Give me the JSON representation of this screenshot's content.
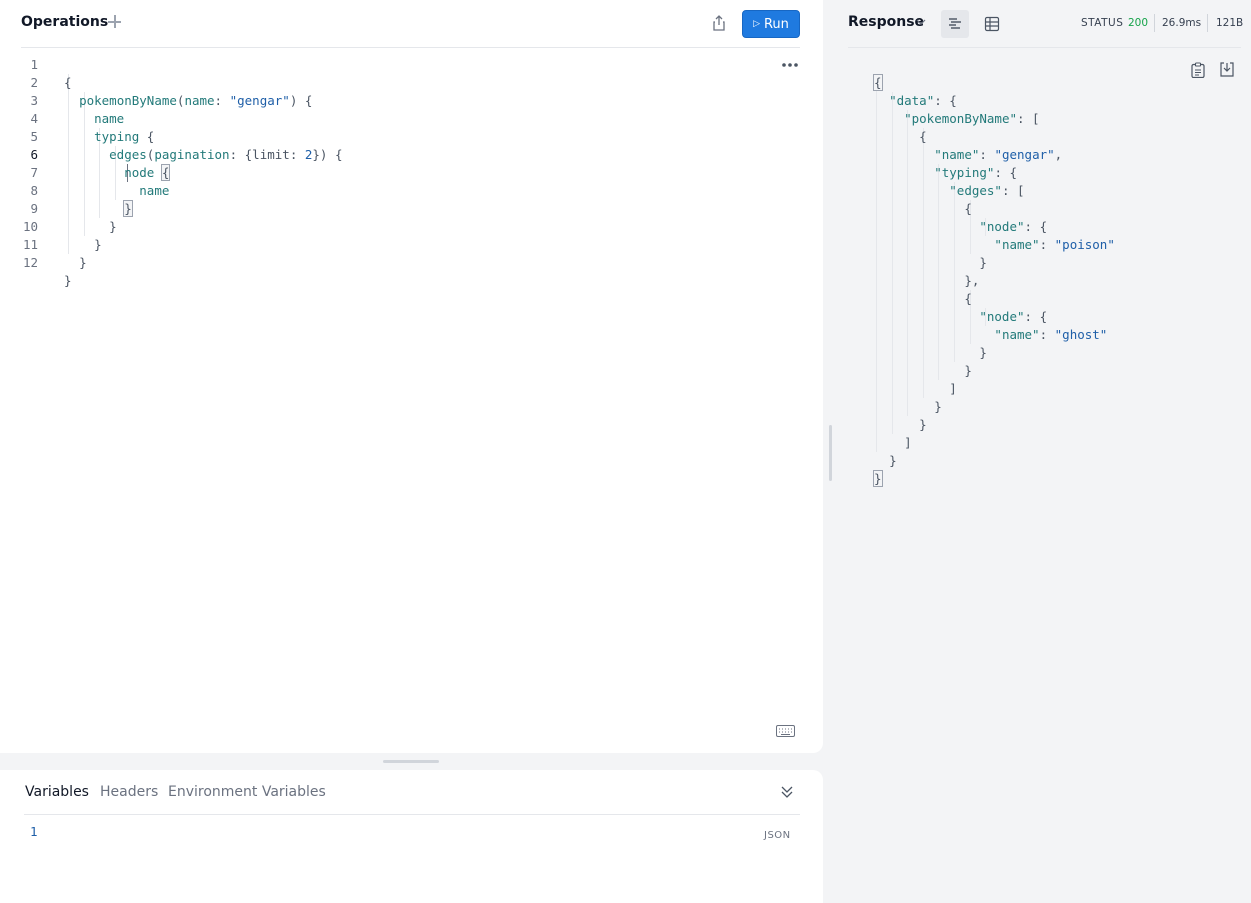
{
  "operations": {
    "title": "Operations",
    "run_label": "Run",
    "line_numbers": [
      "1",
      "2",
      "3",
      "4",
      "5",
      "6",
      "7",
      "8",
      "9",
      "10",
      "11",
      "12"
    ],
    "active_line": "6",
    "code": {
      "l1": "{",
      "l2_field": "pokemonByName",
      "l2_arg": "name",
      "l2_val": "\"gengar\"",
      "l3": "name",
      "l4": "typing",
      "l5_field": "edges",
      "l5_arg": "pagination",
      "l5_key": "limit",
      "l5_num": "2",
      "l6": "node",
      "l7": "name"
    }
  },
  "variables": {
    "tabs": [
      "Variables",
      "Headers",
      "Environment Variables"
    ],
    "line": "1",
    "format_label": "JSON"
  },
  "response": {
    "title": "Response",
    "status_label": "STATUS",
    "status_code": "200",
    "time": "26.9ms",
    "size": "121B",
    "keys": {
      "data": "\"data\"",
      "pokemonByName": "\"pokemonByName\"",
      "name": "\"name\"",
      "typing": "\"typing\"",
      "edges": "\"edges\"",
      "node": "\"node\""
    },
    "values": {
      "gengar": "\"gengar\"",
      "poison": "\"poison\"",
      "ghost": "\"ghost\""
    }
  },
  "colors": {
    "accent": "#1f7ae0",
    "status_ok": "#16a34a",
    "keyword": "#237a7a",
    "string": "#1f5fa8"
  }
}
